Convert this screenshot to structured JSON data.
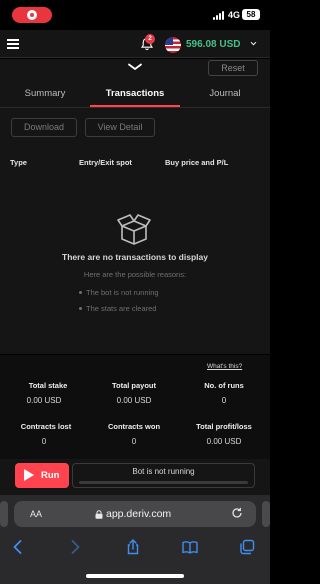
{
  "status_bar": {
    "network": "4G",
    "battery": "58"
  },
  "header": {
    "notification_count": "2",
    "balance": "596.08 USD"
  },
  "toolbar": {
    "reset_label": "Reset"
  },
  "tabs": [
    {
      "label": "Summary"
    },
    {
      "label": "Transactions",
      "active": true
    },
    {
      "label": "Journal"
    }
  ],
  "transactions": {
    "download_label": "Download",
    "view_detail_label": "View Detail",
    "columns": [
      "Type",
      "Entry/Exit spot",
      "Buy price and P/L"
    ],
    "empty_title": "There are no transactions to display",
    "empty_subtitle": "Here are the possible reasons:",
    "reasons": [
      "The bot is not running",
      "The stats are cleared"
    ]
  },
  "stats": {
    "whats_this": "What's this?",
    "items": [
      {
        "label": "Total stake",
        "value": "0.00 USD"
      },
      {
        "label": "Total payout",
        "value": "0.00 USD"
      },
      {
        "label": "No. of runs",
        "value": "0"
      },
      {
        "label": "Contracts lost",
        "value": "0"
      },
      {
        "label": "Contracts won",
        "value": "0"
      },
      {
        "label": "Total profit/loss",
        "value": "0.00 USD"
      }
    ]
  },
  "run_bar": {
    "run_label": "Run",
    "status_text": "Bot is not running",
    "progress": 0
  },
  "browser": {
    "text_size_label": "AA",
    "url": "app.deriv.com"
  },
  "colors": {
    "accent": "#ff444f",
    "balance": "#46c08a"
  }
}
